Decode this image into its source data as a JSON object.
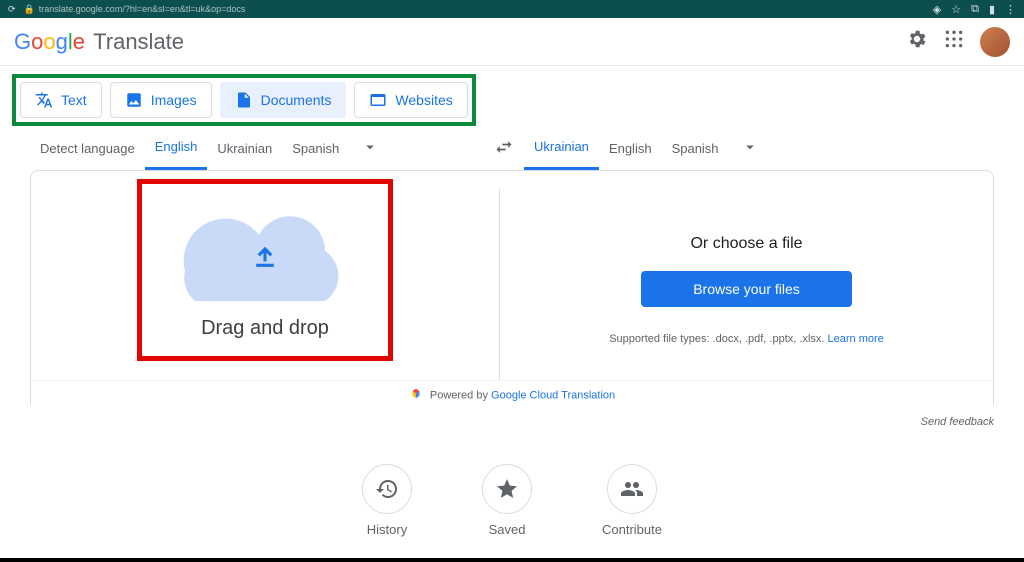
{
  "chrome": {
    "url": "translate.google.com/?hl=en&sl=en&tl=uk&op=docs"
  },
  "header": {
    "brand": "Google",
    "product": "Translate"
  },
  "modes": {
    "text": "Text",
    "images": "Images",
    "documents": "Documents",
    "websites": "Websites"
  },
  "source_langs": {
    "detect": "Detect language",
    "english": "English",
    "ukrainian": "Ukrainian",
    "spanish": "Spanish"
  },
  "target_langs": {
    "ukrainian": "Ukrainian",
    "english": "English",
    "spanish": "Spanish"
  },
  "drop": {
    "label": "Drag and drop"
  },
  "right": {
    "or": "Or choose a file",
    "browse": "Browse your files",
    "supported": "Supported file types: .docx, .pdf, .pptx, .xlsx. ",
    "learn": "Learn more"
  },
  "powered": {
    "prefix": "Powered by ",
    "link": "Google Cloud Translation"
  },
  "feedback": "Send feedback",
  "bottom": {
    "history": "History",
    "saved": "Saved",
    "contribute": "Contribute"
  }
}
